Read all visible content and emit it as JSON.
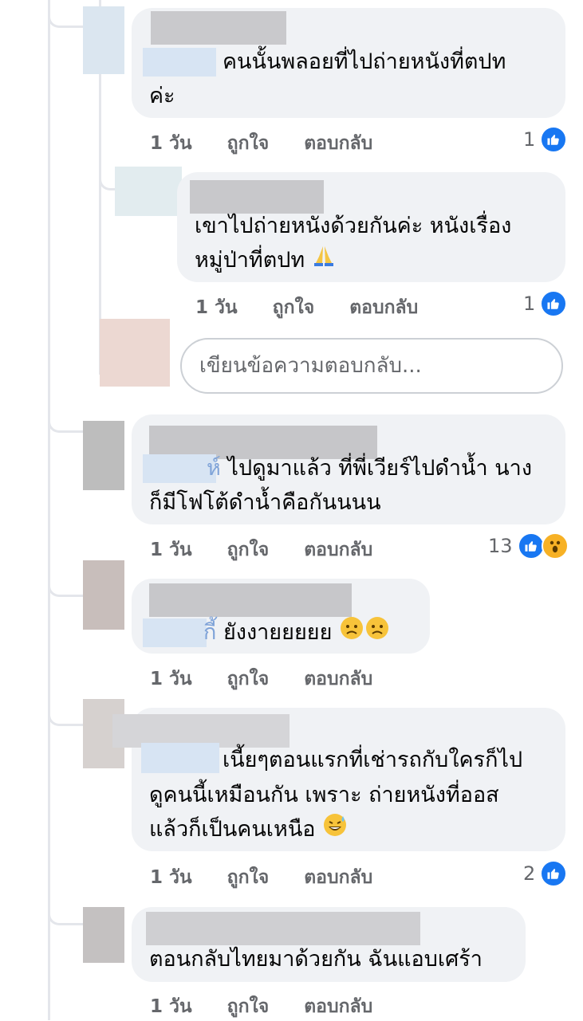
{
  "comments": [
    {
      "text_lines": [
        "คนนั้นพลอยที่ไปถ่ายหนังที่ตปท",
        "ค่ะ"
      ],
      "time": "1 วัน",
      "like": "ถูกใจ",
      "reply": "ตอบกลับ",
      "reaction_count": "1"
    },
    {
      "text_lines": [
        "เขาไปถ่ายหนังด้วยกันค่ะ  หนังเรื่อง",
        "หมู่ป่าที่ตปท"
      ],
      "time": "1 วัน",
      "like": "ถูกใจ",
      "reply": "ตอบกลับ",
      "reaction_count": "1"
    },
    {
      "tag_tail": "ห์",
      "text_lines": [
        "ไปดูมาแล้ว ที่พี่เวียร์ไปดำน้ำ นาง",
        "ก็มีโฟโต้ดำน้ำคือกันนนน"
      ],
      "time": "1 วัน",
      "like": "ถูกใจ",
      "reply": "ตอบกลับ",
      "reaction_count": "13"
    },
    {
      "tag_tail": "กี้",
      "text_lines": [
        "ยังงายยยยย"
      ],
      "time": "1 วัน",
      "like": "ถูกใจ",
      "reply": "ตอบกลับ"
    },
    {
      "text_lines": [
        "เนี้ยๆตอนแรกที่เช่ารถกับใครก็ไป",
        "ดูคนนี้เหมือนกัน เพราะ ถ่ายหนังที่ออส",
        "แล้วก็เป็นคนเหนือ"
      ],
      "time": "1 วัน",
      "like": "ถูกใจ",
      "reply": "ตอบกลับ",
      "reaction_count": "2"
    },
    {
      "text_lines": [
        "ตอนกลับไทยมาด้วยกัน ฉันแอบเศร้า"
      ],
      "time": "1 วัน",
      "like": "ถูกใจ",
      "reply": "ตอบกลับ"
    }
  ],
  "reply_box": {
    "placeholder": "เขียนข้อความตอบกลับ..."
  },
  "icons": {
    "like": "like-icon",
    "wow": "wow-icon",
    "pray": "folded-hands-icon",
    "sad": "sad-face-icon",
    "grin": "grinning-sweat-icon"
  },
  "colors": {
    "bubble": "#f0f2f5",
    "like_blue": "#1877f2",
    "meta_grey": "#65676b",
    "thread_line": "#e4e6eb"
  }
}
